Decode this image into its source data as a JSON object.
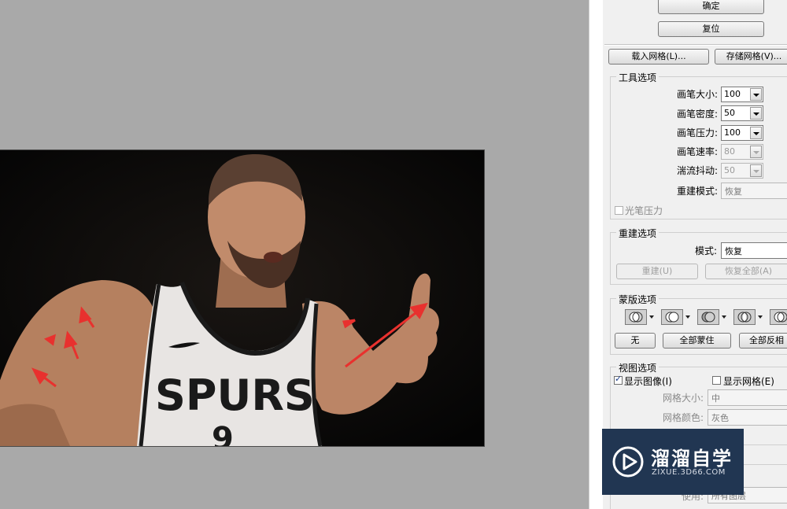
{
  "panel": {
    "ok_label": "确定",
    "reset_label": "复位",
    "load_mesh_label": "载入网格(L)...",
    "save_mesh_label": "存储网格(V)...",
    "tool_options": {
      "legend": "工具选项",
      "brush_size": {
        "label": "画笔大小:",
        "value": "100"
      },
      "brush_density": {
        "label": "画笔密度:",
        "value": "50"
      },
      "brush_pressure": {
        "label": "画笔压力:",
        "value": "100"
      },
      "brush_rate": {
        "label": "画笔速率:",
        "value": "80"
      },
      "turbulent_jitter": {
        "label": "湍流抖动:",
        "value": "50"
      },
      "reconstruct_mode": {
        "label": "重建模式:",
        "value": "恢复"
      },
      "stylus_pressure_label": "光笔压力"
    },
    "reconstruct_options": {
      "legend": "重建选项",
      "mode": {
        "label": "模式:",
        "value": "恢复"
      },
      "reconstruct_label": "重建(U)",
      "restore_all_label": "恢复全部(A)"
    },
    "mask_options": {
      "legend": "蒙版选项",
      "none_label": "无",
      "mask_all_label": "全部蒙住",
      "invert_all_label": "全部反相"
    },
    "view_options": {
      "legend": "视图选项",
      "show_image_label": "显示图像(I)",
      "show_image_checked": true,
      "show_mesh_label": "显示网格(E)",
      "show_mesh_checked": false,
      "mesh_size": {
        "label": "网格大小:",
        "value": "中"
      },
      "mesh_color": {
        "label": "网格颜色:",
        "value": "灰色"
      },
      "use": {
        "label": "使用:",
        "value": "所有图层"
      }
    }
  },
  "photo": {
    "jersey_text": "SPURS",
    "jersey_number": "9",
    "colors": {
      "background": "#060606",
      "jersey": "#e9e6e4",
      "skin": "#b98565",
      "arrow": "#e8312e"
    }
  },
  "watermark": {
    "title": "溜溜自学",
    "url": "ZIXUE.3D66.COM",
    "icon": "play-logo-icon"
  },
  "colors": {
    "canvas_bg": "#a9a9a9",
    "panel_bg": "#f0f0f0",
    "watermark_bg": "#213652"
  }
}
